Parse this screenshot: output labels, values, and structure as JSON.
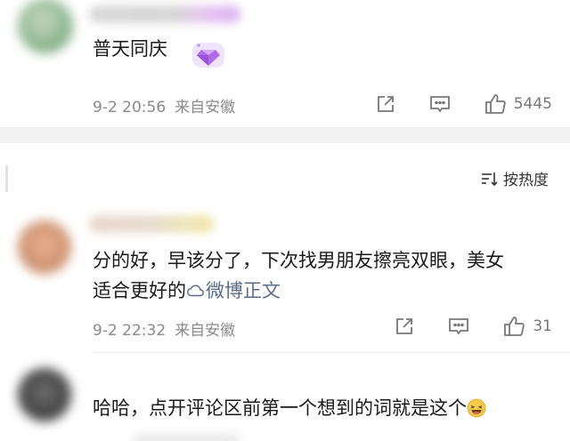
{
  "comments": [
    {
      "text": "普天同庆",
      "time": "9-2 20:56",
      "source": "来自安徽",
      "likes": "5445"
    },
    {
      "text_line1": "分的好，早该分了，下次找男朋友擦亮双眼，美女",
      "text_line2_prefix": "适合更好的",
      "link_text": "微博正文",
      "time": "9-2 22:32",
      "source": "来自安徽",
      "likes": "31"
    },
    {
      "text": "哈哈，点开评论区前第一个想到的词就是这个"
    }
  ],
  "sort": {
    "label": "按热度"
  },
  "icons": {
    "share": "share-icon",
    "comment": "comment-icon",
    "like": "thumb-up-icon",
    "sort": "sort-icon",
    "link": "weibo-link-icon",
    "badge": "diamond-badge-icon",
    "emoji": "laughing-emoji-icon"
  },
  "colors": {
    "text": "#1a1a1a",
    "meta": "#8a8a8a",
    "link": "#5a6b8c",
    "badge": "#b06ce8",
    "band": "#f2f2f2"
  }
}
